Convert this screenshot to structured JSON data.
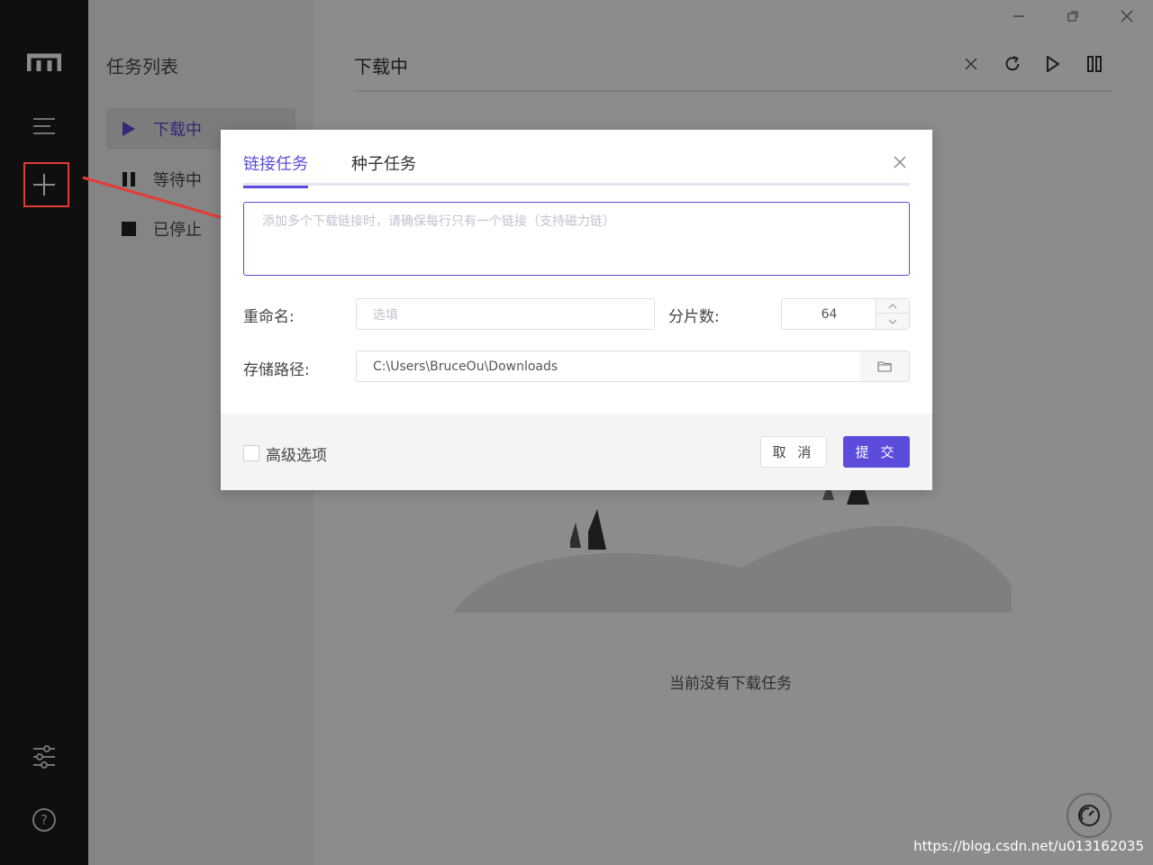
{
  "app": {
    "rail_icons": [
      "logo-icon",
      "menu-icon",
      "plus-icon",
      "settings-sliders-icon",
      "help-icon"
    ]
  },
  "subnav": {
    "title": "任务列表",
    "items": [
      {
        "label": "下载中",
        "icon": "play-icon",
        "active": true
      },
      {
        "label": "等待中",
        "icon": "pause-icon",
        "active": false
      },
      {
        "label": "已停止",
        "icon": "stop-icon",
        "active": false
      }
    ]
  },
  "main": {
    "title": "下载中",
    "empty_text": "当前没有下载任务"
  },
  "dialog": {
    "tabs": [
      "链接任务",
      "种子任务"
    ],
    "active_tab": 0,
    "url_placeholder": "添加多个下载链接时，请确保每行只有一个链接（支持磁力链）",
    "rename_label": "重命名:",
    "rename_placeholder": "选填",
    "split_label": "分片数:",
    "split_value": "64",
    "path_label": "存储路径:",
    "path_value": "C:\\Users\\BruceOu\\Downloads",
    "advanced_label": "高级选项",
    "cancel_label": "取 消",
    "submit_label": "提 交"
  },
  "watermark": "https://blog.csdn.net/u013162035",
  "colors": {
    "accent": "#5b4cdb",
    "highlight": "#e53935",
    "rail": "#1d1d1d"
  }
}
